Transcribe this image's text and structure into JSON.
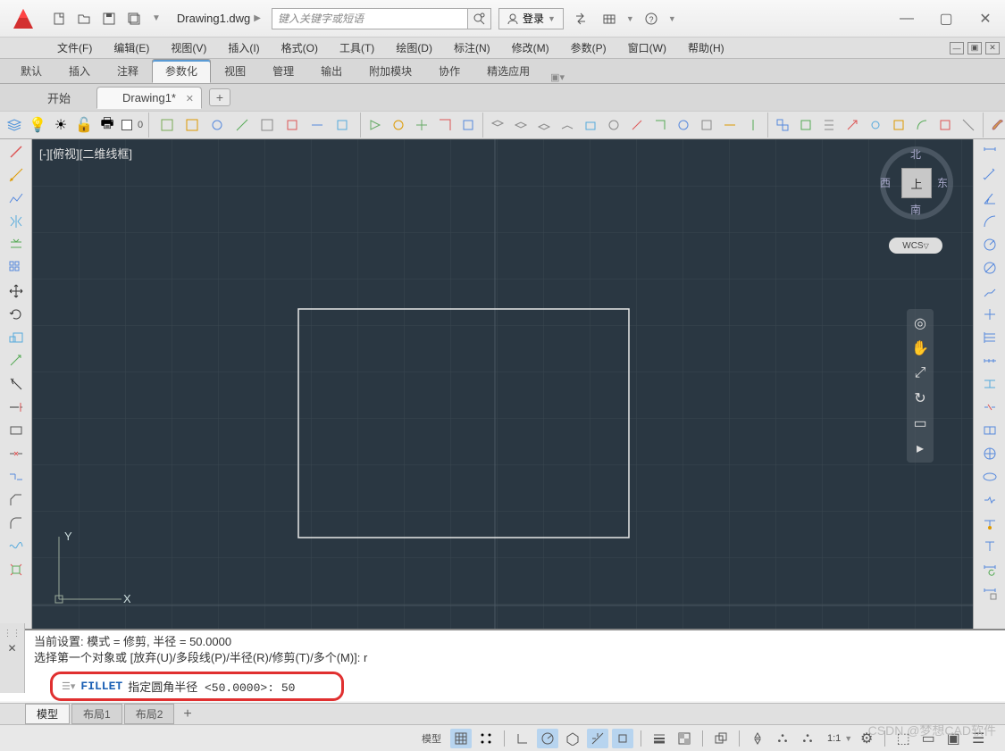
{
  "title": {
    "document": "Drawing1.dwg",
    "search_placeholder": "键入关键字或短语",
    "login": "登录"
  },
  "menubar": {
    "items": [
      "文件(F)",
      "编辑(E)",
      "视图(V)",
      "插入(I)",
      "格式(O)",
      "工具(T)",
      "绘图(D)",
      "标注(N)",
      "修改(M)",
      "参数(P)",
      "窗口(W)",
      "帮助(H)"
    ]
  },
  "ribbon_tabs": {
    "items": [
      "默认",
      "插入",
      "注释",
      "参数化",
      "视图",
      "管理",
      "输出",
      "附加模块",
      "协作",
      "精选应用"
    ],
    "active_index": 3
  },
  "file_tabs": {
    "items": [
      "开始",
      "Drawing1*"
    ],
    "active_index": 1
  },
  "toolbar_layer_text": "0",
  "canvas": {
    "top_left_label": "[-][俯视][二维线框]",
    "ucs_x": "X",
    "ucs_y": "Y",
    "viewcube": {
      "n": "北",
      "s": "南",
      "e": "东",
      "w": "西",
      "center": "上",
      "wcs": "WCS"
    }
  },
  "command": {
    "history_line1": "当前设置: 模式 = 修剪, 半径 = 50.0000",
    "history_line2": "选择第一个对象或 [放弃(U)/多段线(P)/半径(R)/修剪(T)/多个(M)]: r",
    "prompt_name": "FILLET",
    "prompt_text": "指定圆角半径 <50.0000>: 50"
  },
  "layout_tabs": {
    "items": [
      "模型",
      "布局1",
      "布局2"
    ],
    "active_index": 0
  },
  "statusbar": {
    "mode_label": "模型",
    "scale": "1:1"
  },
  "watermark": "CSDN @梦想CAD软件"
}
